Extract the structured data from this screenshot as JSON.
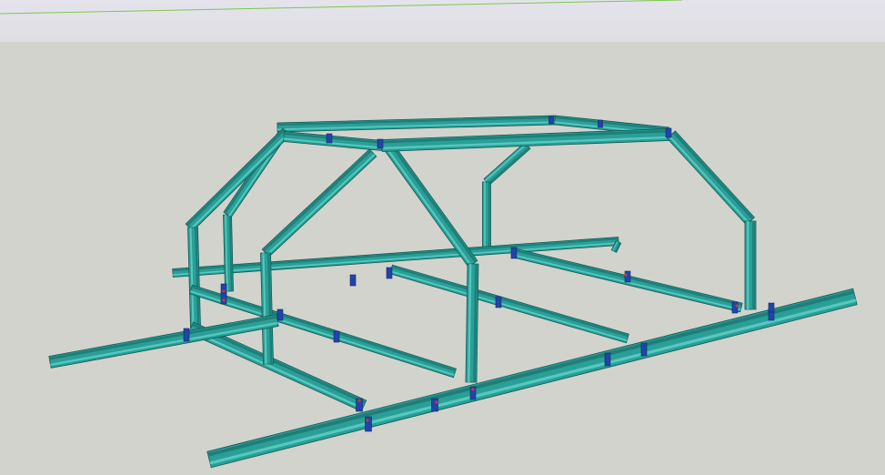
{
  "viewport": {
    "sky_top_color": "#e4e3ec",
    "sky_bottom_color": "#dcdcde",
    "ground_color": "#d2d3cc",
    "horizon_line_color": "#7cc84a"
  },
  "model": {
    "member_color": "#2a9f97",
    "member_dark_color": "#1f7e78",
    "member_light_color": "#56c8bf",
    "member_edge_color": "#0f5a55",
    "plate_color": "#2244a8",
    "bolt_color": "#c23a3a"
  }
}
